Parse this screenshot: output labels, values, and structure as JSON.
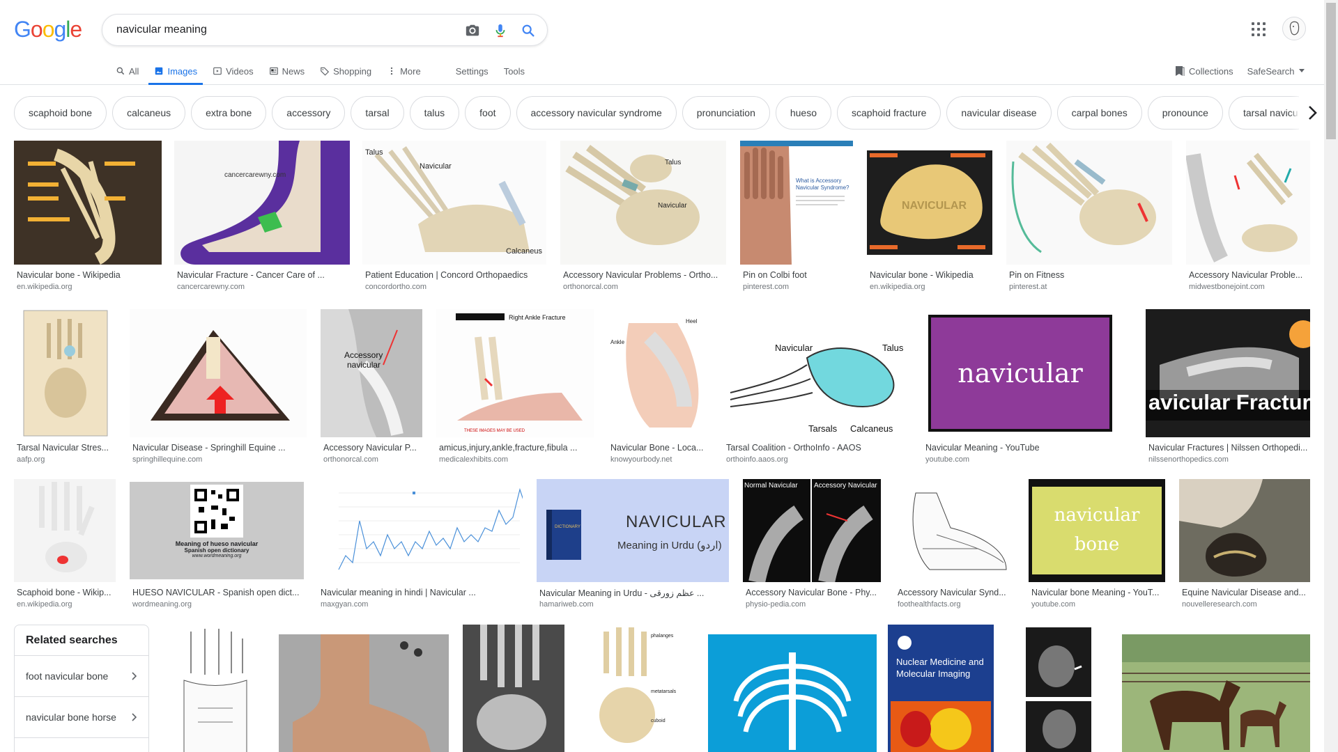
{
  "logo": [
    "G",
    "o",
    "o",
    "g",
    "l",
    "e"
  ],
  "search": {
    "value": "navicular meaning"
  },
  "tabs": [
    {
      "label": "All"
    },
    {
      "label": "Images"
    },
    {
      "label": "Videos"
    },
    {
      "label": "News"
    },
    {
      "label": "Shopping"
    },
    {
      "label": "More"
    }
  ],
  "tab_links": {
    "settings": "Settings",
    "tools": "Tools"
  },
  "right_tools": {
    "collections": "Collections",
    "safesearch": "SafeSearch"
  },
  "chips": [
    "scaphoid bone",
    "calcaneus",
    "extra bone",
    "accessory",
    "tarsal",
    "talus",
    "foot",
    "accessory navicular syndrome",
    "pronunciation",
    "hueso",
    "scaphoid fracture",
    "navicular disease",
    "carpal bones",
    "pronounce",
    "tarsal navicu"
  ],
  "results": {
    "row1": [
      {
        "title": "Navicular bone - Wikipedia",
        "source": "en.wikipedia.org"
      },
      {
        "title": "Navicular Fracture - Cancer Care of ...",
        "source": "cancercarewny.com"
      },
      {
        "title": "Patient Education | Concord Orthopaedics",
        "source": "concordortho.com"
      },
      {
        "title": "Accessory Navicular Problems - Ortho...",
        "source": "orthonorcal.com"
      },
      {
        "title": "Pin on Colbi foot",
        "source": "pinterest.com"
      },
      {
        "title": "Navicular bone - Wikipedia",
        "source": "en.wikipedia.org"
      },
      {
        "title": "Pin on Fitness",
        "source": "pinterest.at"
      },
      {
        "title": "Accessory Navicular Proble...",
        "source": "midwestbonejoint.com"
      }
    ],
    "row2": [
      {
        "title": "Tarsal Navicular Stres...",
        "source": "aafp.org"
      },
      {
        "title": "Navicular Disease - Springhill Equine ...",
        "source": "springhillequine.com"
      },
      {
        "title": "Accessory Navicular P...",
        "source": "orthonorcal.com"
      },
      {
        "title": "amicus,injury,ankle,fracture,fibula ...",
        "source": "medicalexhibits.com"
      },
      {
        "title": "Navicular Bone - Loca...",
        "source": "knowyourbody.net"
      },
      {
        "title": "Tarsal Coalition - OrthoInfo - AAOS",
        "source": "orthoinfo.aaos.org"
      },
      {
        "title": "Navicular Meaning - YouTube",
        "source": "youtube.com"
      },
      {
        "title": "Navicular Fractures | Nilssen Orthopedi...",
        "source": "nilssenorthopedics.com"
      }
    ],
    "row3": [
      {
        "title": "Scaphoid bone - Wikip...",
        "source": "en.wikipedia.org"
      },
      {
        "title": "HUESO NAVICULAR - Spanish open dict...",
        "source": "wordmeaning.org"
      },
      {
        "title": "Navicular meaning in hindi | Navicular ...",
        "source": "maxgyan.com"
      },
      {
        "title": "Navicular Meaning in Urdu - عظم زورقی ...",
        "source": "hamariweb.com"
      },
      {
        "title": "Accessory Navicular Bone - Phy...",
        "source": "physio-pedia.com"
      },
      {
        "title": "Accessory Navicular Synd...",
        "source": "foothealthfacts.org"
      },
      {
        "title": "Navicular bone Meaning - YouT...",
        "source": "youtube.com"
      },
      {
        "title": "Equine Navicular Disease and...",
        "source": "nouvelleresearch.com"
      }
    ]
  },
  "thumb_text": {
    "navicular_youtube": "navicular",
    "fractures_banner": "avicular Fractures",
    "hueso_caption": "Meaning of hueso navicular",
    "hueso_sub": "Spanish open dictionary",
    "hueso_url": "www.wordmeaning.org",
    "urdu_title": "NAVICULAR",
    "urdu_sub": "Meaning in Urdu (اردو)",
    "bone_line1": "navicular",
    "bone_line2": "bone",
    "nuclear_title": "Nuclear Medicine and Molecular Imaging",
    "wiki_bone_label": "NAVICULAR",
    "xray_normal": "Normal Navicular",
    "xray_accessory": "Accessory Navicular",
    "ankle_fracture_title": "Right Ankle Fracture",
    "talus": "Talus",
    "calcaneus": "Calcaneus",
    "navicular": "Navicular",
    "tarsals": "Tarsals"
  },
  "related": {
    "heading": "Related searches",
    "items": [
      "foot navicular bone",
      "navicular bone horse"
    ]
  },
  "colors": {
    "accent": "#1a73e8",
    "youtube_purple": "#8e3a99",
    "urdu_bg": "#c8d4f5",
    "bone_yellow": "#d9dc6e",
    "xray_blue": "#0c9ed8"
  }
}
